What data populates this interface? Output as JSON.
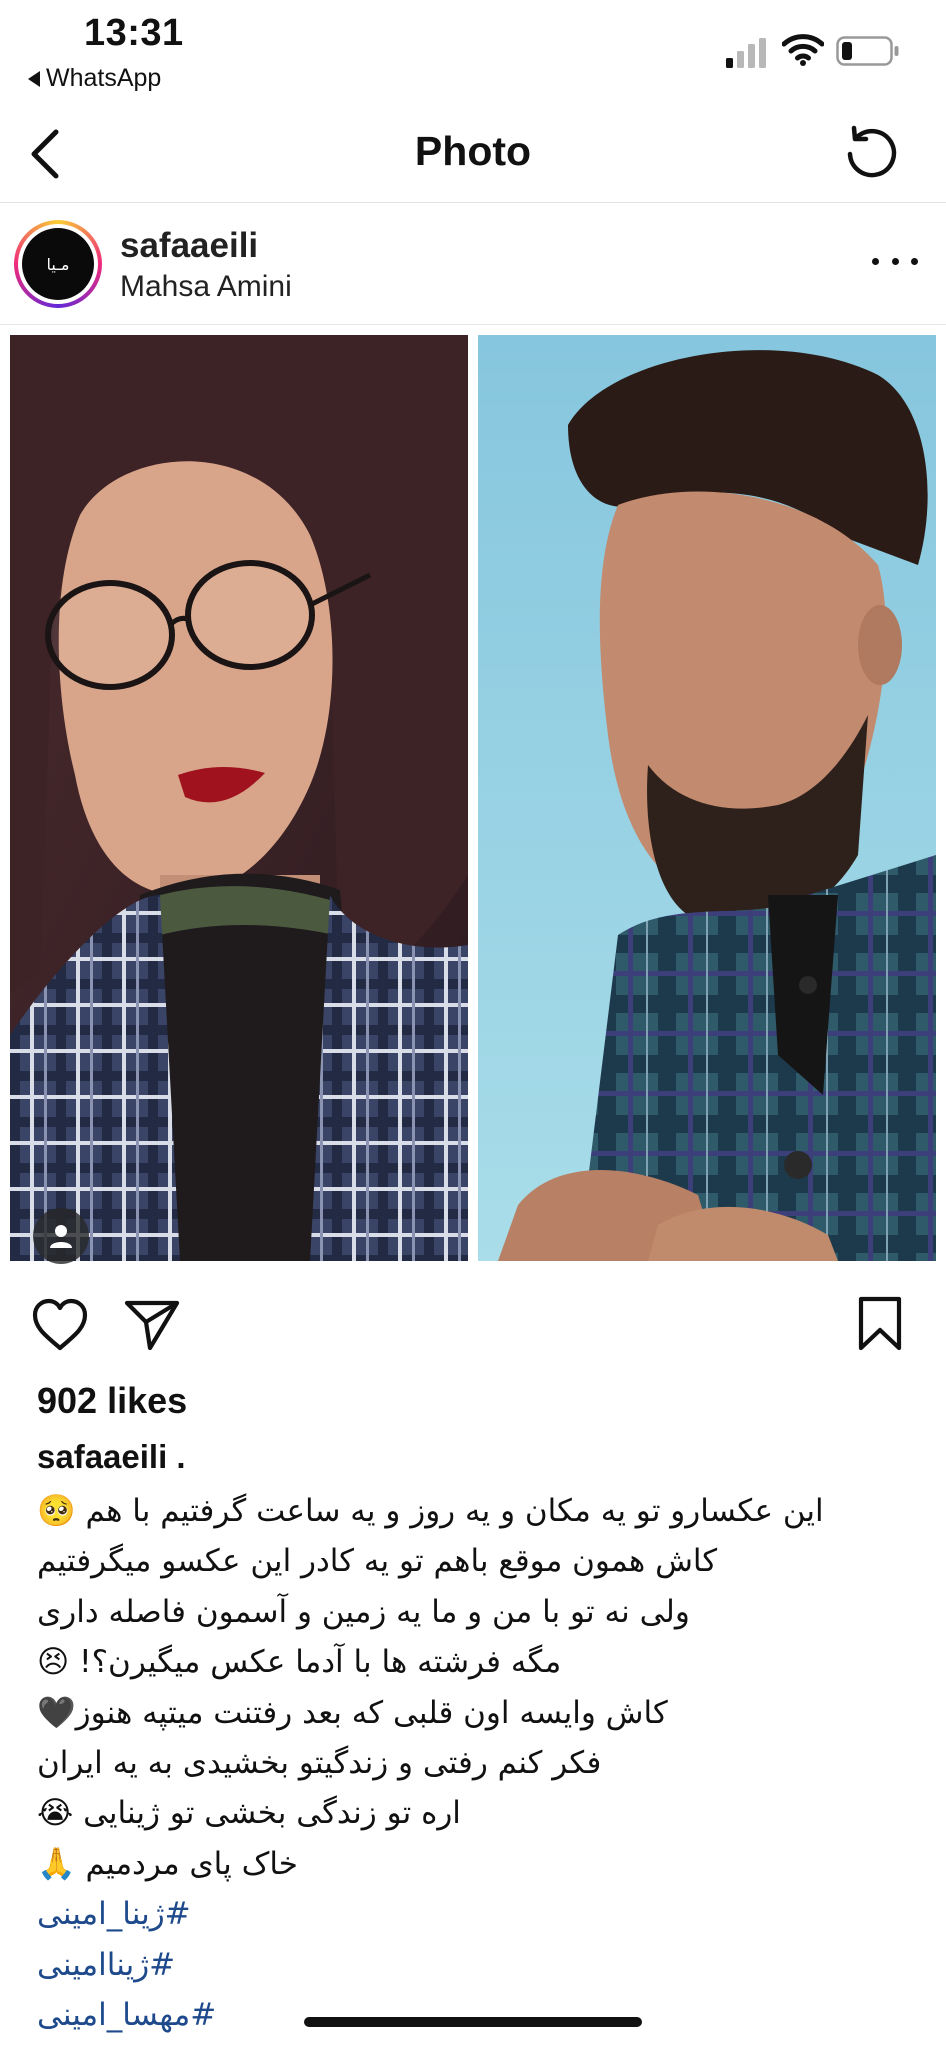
{
  "status_bar": {
    "time": "13:31",
    "back_app": "WhatsApp",
    "icons": [
      "signal-bars-icon",
      "wifi-icon",
      "battery-icon"
    ]
  },
  "nav": {
    "title": "Photo",
    "back_icon": "chevron-left-icon",
    "refresh_icon": "refresh-icon"
  },
  "post": {
    "username": "safaaeili",
    "location": "Mahsa Amini",
    "avatar_text": "مـیا",
    "more_icon": "more-horizontal-icon"
  },
  "photo": {
    "tag_icon": "person-icon"
  },
  "actions": {
    "like_icon": "heart-icon",
    "share_icon": "paper-plane-icon",
    "save_icon": "bookmark-icon"
  },
  "likes": "902 likes",
  "caption": {
    "username": "safaaeili .",
    "lines": [
      "این عکسارو تو یه  مکان و یه روز و یه ساعت گرفتیم با هم 🥺",
      "کاش همون موقع باهم تو یه کادر این عکسو میگرفتیم",
      "ولی نه تو با من و ما یه زمین و آسمون فاصله داری",
      "مگه فرشته ها با آدما عکس میگیرن؟! 😣",
      "کاش وایسه اون قلبی که بعد رفتنت میتپه هنوز🖤",
      "فکر کنم رفتی و زندگیتو بخشیدی به یه ایران",
      "اره تو زندگی بخشی  تو ژینایی 😭",
      "خاک پای مردمیم 🙏"
    ],
    "hashtags": [
      "#ژینا_امینی",
      "#ژیناامینی",
      "#مهسا_امینی"
    ]
  },
  "colors": {
    "hashtag": "#1e4a8c",
    "text": "#111111",
    "divider": "#e3e3e3"
  }
}
